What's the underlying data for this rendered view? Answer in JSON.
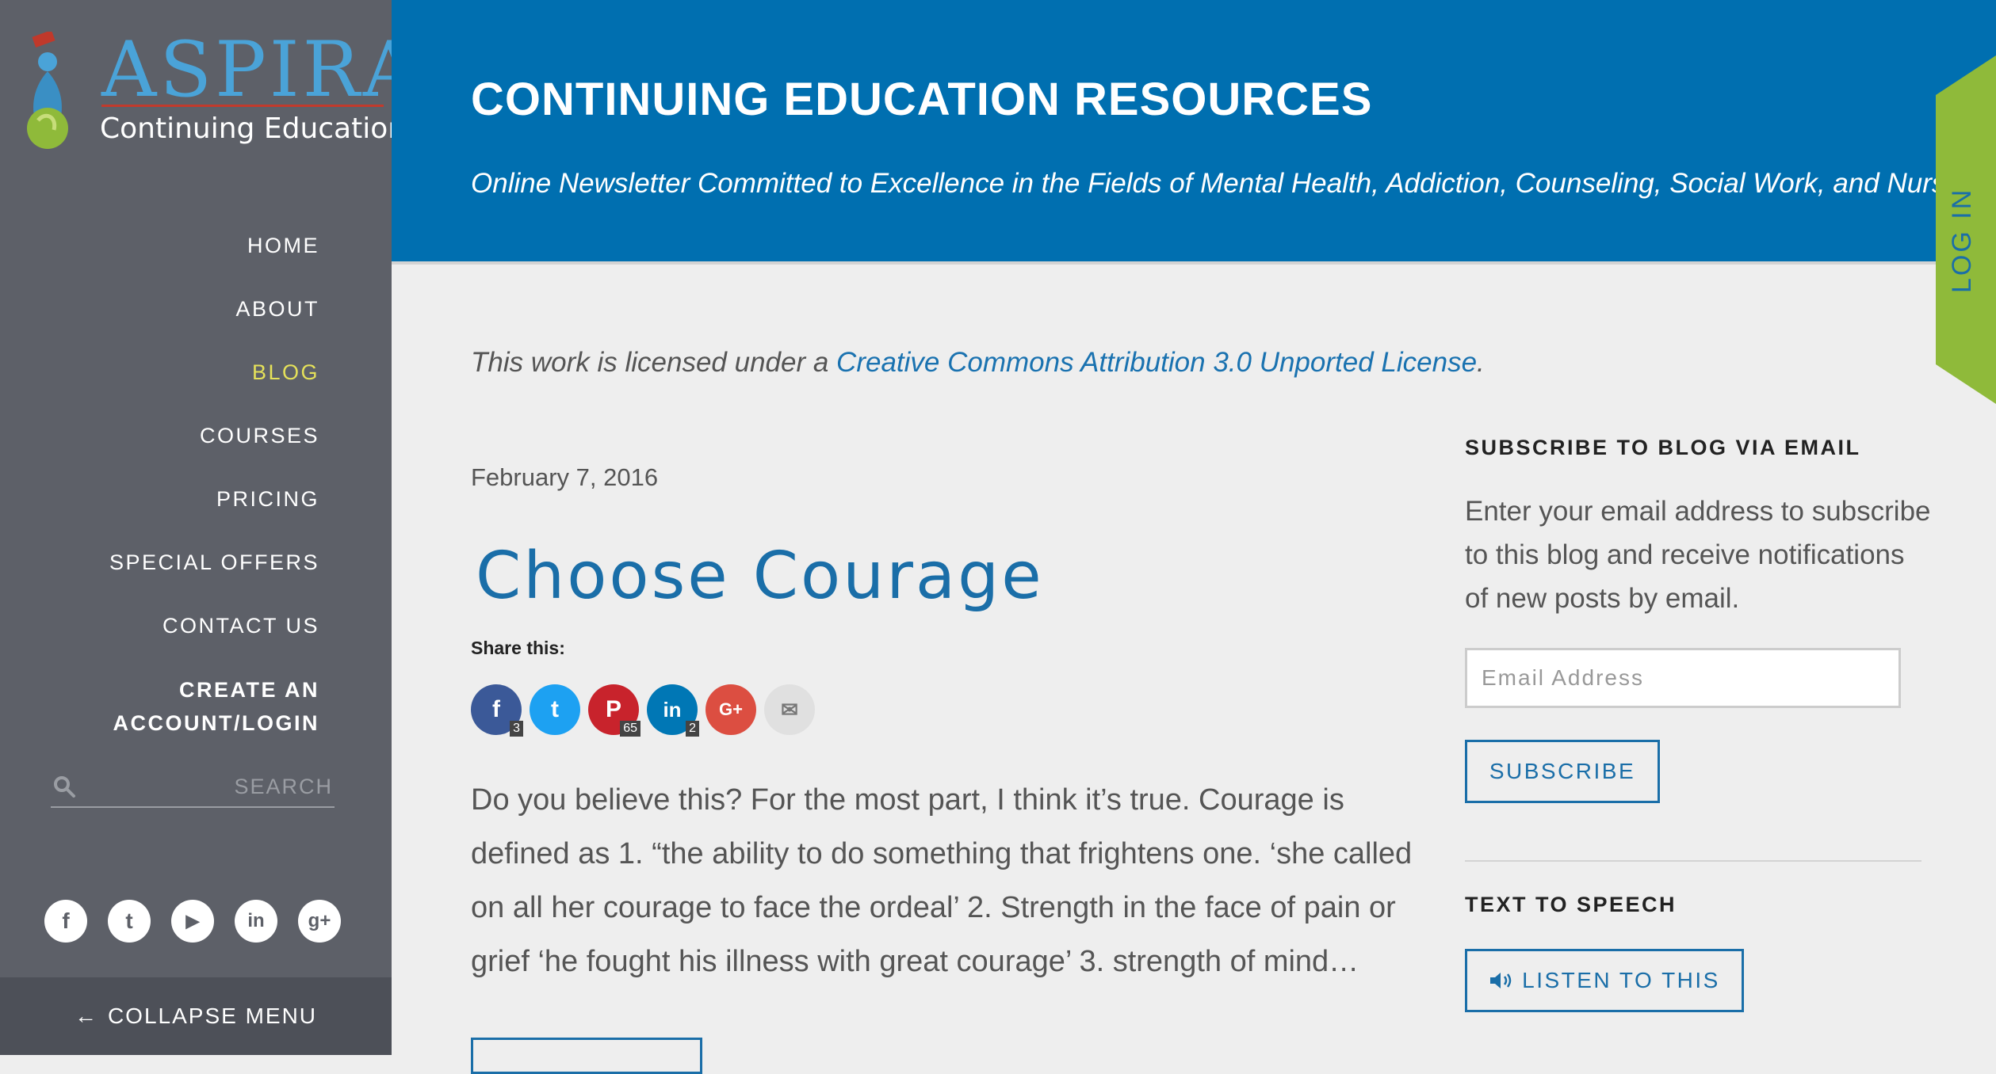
{
  "logo": {
    "word": "ASPIRA",
    "tagline": "Continuing Education"
  },
  "nav": {
    "items": [
      {
        "label": "HOME"
      },
      {
        "label": "ABOUT"
      },
      {
        "label": "BLOG"
      },
      {
        "label": "COURSES"
      },
      {
        "label": "PRICING"
      },
      {
        "label": "SPECIAL OFFERS"
      },
      {
        "label": "CONTACT US"
      }
    ],
    "account_line1": "CREATE AN",
    "account_line2": "ACCOUNT/LOGIN",
    "active": "BLOG"
  },
  "search": {
    "placeholder": "SEARCH",
    "icon": "search-icon"
  },
  "socials": [
    {
      "icon": "facebook-icon",
      "glyph": "f"
    },
    {
      "icon": "twitter-icon",
      "glyph": "t"
    },
    {
      "icon": "youtube-icon",
      "glyph": "▶"
    },
    {
      "icon": "linkedin-icon",
      "glyph": "in"
    },
    {
      "icon": "googleplus-icon",
      "glyph": "g+"
    }
  ],
  "collapse": {
    "arrow": "←",
    "label": "COLLAPSE MENU"
  },
  "header": {
    "title": "CONTINUING EDUCATION RESOURCES",
    "subtitle": "Online Newsletter Committed to Excellence in the Fields of Mental Health, Addiction, Counseling, Social Work, and Nursing"
  },
  "login_tab": {
    "label": "LOG IN"
  },
  "license": {
    "prefix": "This work is licensed under a ",
    "link": "Creative Commons Attribution 3.0 Unported License",
    "suffix": "."
  },
  "post": {
    "date": "February 7, 2016",
    "title": "Choose Courage",
    "share_label": "Share this:",
    "share": [
      {
        "icon": "facebook-share-icon",
        "glyph": "f",
        "count": "3",
        "color": "#3b5998"
      },
      {
        "icon": "twitter-share-icon",
        "glyph": "t",
        "count": "",
        "color": "#1da1f2"
      },
      {
        "icon": "pinterest-share-icon",
        "glyph": "P",
        "count": "65",
        "color": "#c8232c"
      },
      {
        "icon": "linkedin-share-icon",
        "glyph": "in",
        "count": "2",
        "color": "#0077b5"
      },
      {
        "icon": "googleplus-share-icon",
        "glyph": "G+",
        "count": "",
        "color": "#dc4e41"
      },
      {
        "icon": "email-share-icon",
        "glyph": "✉",
        "count": "",
        "color": "#e0e0e0"
      }
    ],
    "excerpt": "  Do you believe this? For the most part, I think it’s true. Courage is defined as  1. “the ability to do something that frightens one. ‘she called on all her courage to face the ordeal’ 2.  Strength in the face of pain or grief ‘he fought his illness with great courage’  3. strength of mind…"
  },
  "subscribe": {
    "title": "SUBSCRIBE TO BLOG VIA EMAIL",
    "text": "Enter your email address to subscribe to this blog and receive notifications of new posts by email.",
    "placeholder": "Email Address",
    "button": "SUBSCRIBE"
  },
  "tts": {
    "title": "TEXT TO SPEECH",
    "button": "LISTEN TO THIS",
    "icon": "speaker-icon"
  },
  "colors": {
    "sidebar": "#5d6068",
    "header": "#006fb0",
    "accent": "#1a6ea8",
    "active_nav": "#e5e15a",
    "login_tab": "#8fba3a"
  }
}
